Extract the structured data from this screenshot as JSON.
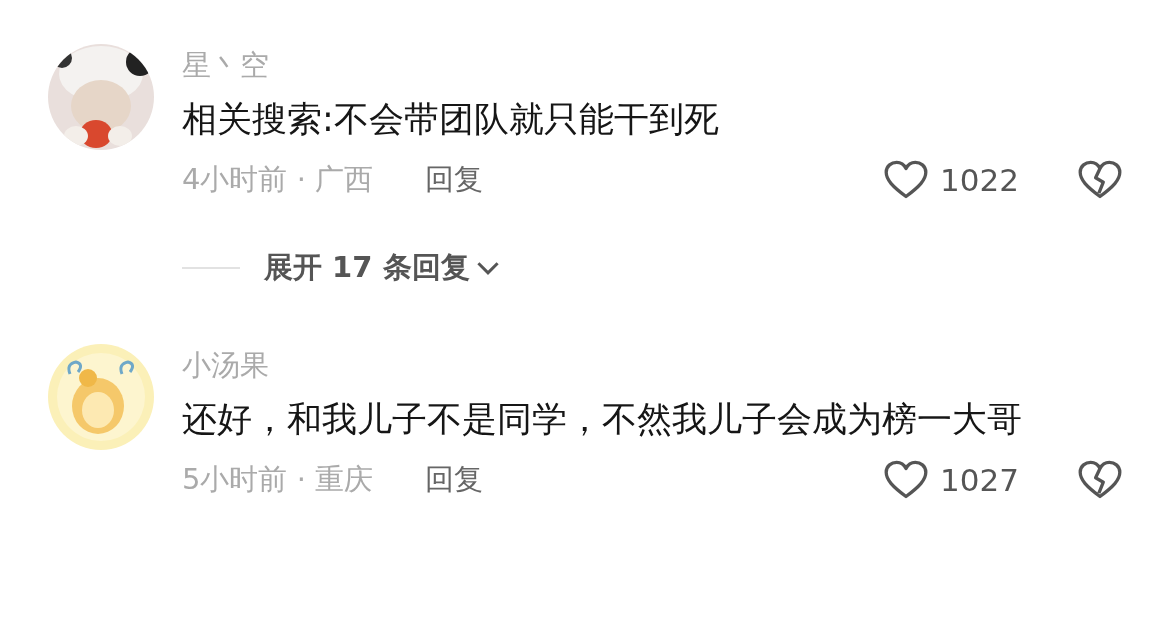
{
  "comments": [
    {
      "username": "星丶空",
      "text": "相关搜索:不会带团队就只能干到死",
      "meta": "4小时前 · 广西",
      "reply_label": "回复",
      "likes": "1022",
      "expand_label": "展开 17 条回复"
    },
    {
      "username": "小汤果",
      "text": "还好，和我儿子不是同学，不然我儿子会成为榜一大哥",
      "meta": "5小时前 · 重庆",
      "reply_label": "回复",
      "likes": "1027"
    }
  ]
}
